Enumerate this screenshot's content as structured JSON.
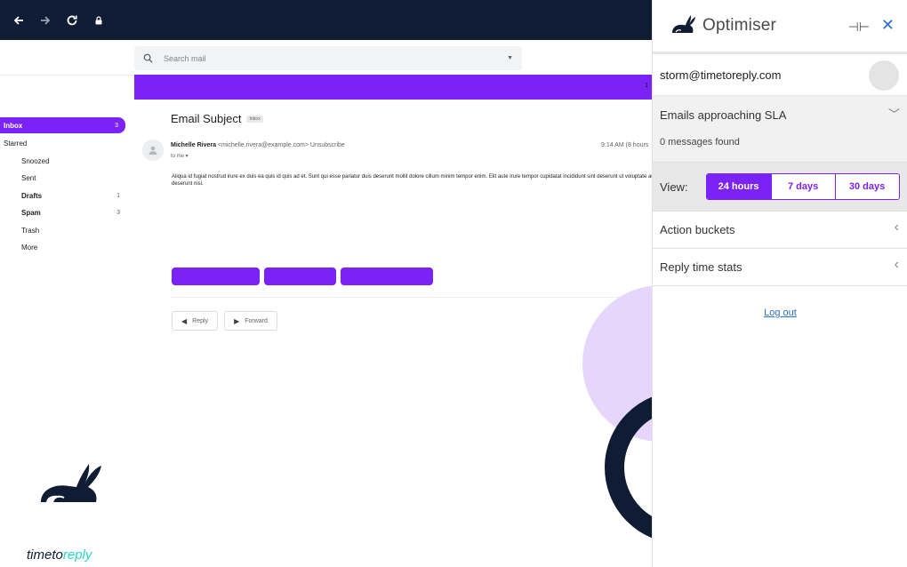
{
  "browser": {
    "back_icon": "arrow-left-icon",
    "forward_icon": "arrow-right-icon",
    "reload_icon": "reload-icon",
    "lock_icon": "lock-icon"
  },
  "gmail": {
    "search_placeholder": "Search mail",
    "banner_count": "1",
    "sidebar": [
      {
        "label": "Inbox",
        "count": "3"
      },
      {
        "label": "Starred",
        "count": ""
      },
      {
        "label": "Snoozed",
        "count": ""
      },
      {
        "label": "Sent",
        "count": ""
      },
      {
        "label": "Drafts",
        "count": "1"
      },
      {
        "label": "Spam",
        "count": "3"
      },
      {
        "label": "Trash",
        "count": ""
      },
      {
        "label": "More",
        "count": ""
      }
    ],
    "subject": "Email Subject",
    "subject_tag": "Inbox",
    "sender_name": "Michelle Rivera",
    "sender_email": "<michelle.rivera@example.com>",
    "unsubscribe": "Unsubscribe",
    "to_me": "to me ▾",
    "time": "9:14 AM (8 hours",
    "body": "Aliqua id fugiat nostrud irure ex duis ea quis id quis ad et. Sunt qui esse pariatur duis deserunt mollit dolore cillum minim tempor enim. Elit aute irure tempor cupidatat incididunt sint deserunt ut voluptate aute id deserunt nisi.",
    "reply_label": "Reply",
    "forward_label": "Forward"
  },
  "brand": {
    "logo_part1": "timeto",
    "logo_part2": "reply",
    "colors": {
      "accent": "#7b22f6",
      "navy": "#0f1c33",
      "teal": "#2bd4c7",
      "lilac": "#e7d6fb"
    }
  },
  "panel": {
    "title": "Optimiser",
    "pin_icon": "pin-icon",
    "close_icon": "close-icon",
    "email": "storm@timetoreply.com",
    "sla_title": "Emails approaching SLA",
    "sla_found": "0 messages found",
    "view_label": "View:",
    "view_options": [
      "24 hours",
      "7 days",
      "30 days"
    ],
    "view_selected": "24 hours",
    "action_buckets": "Action buckets",
    "reply_stats": "Reply time stats",
    "logout": "Log out"
  }
}
